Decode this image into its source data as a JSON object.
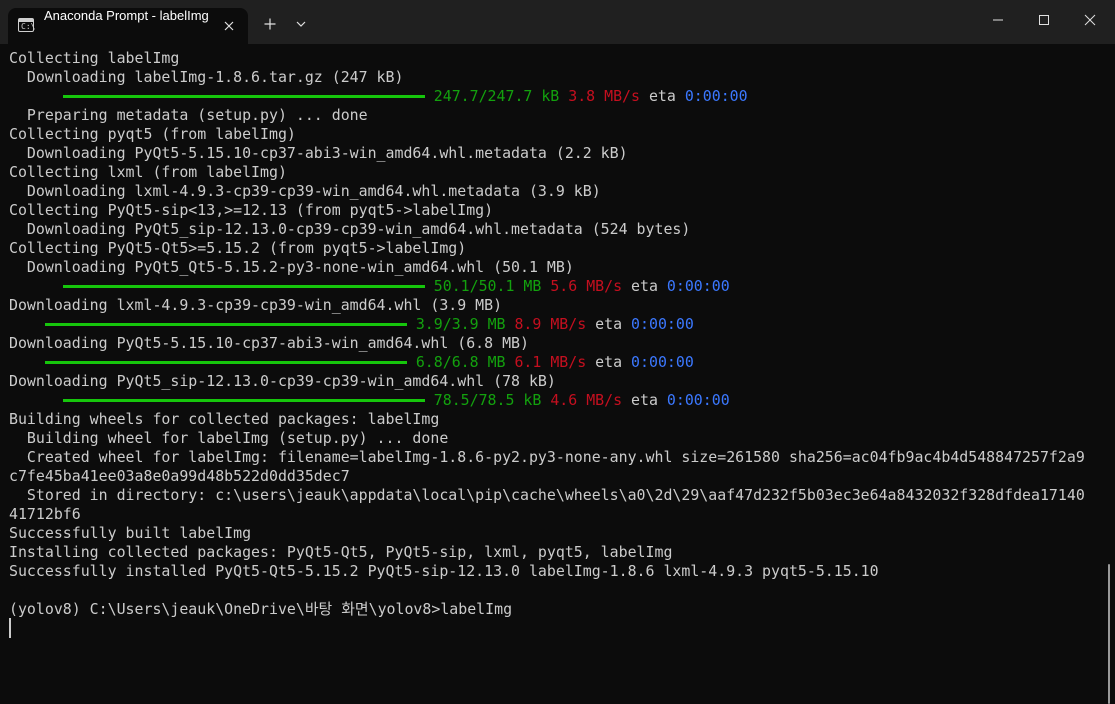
{
  "window": {
    "tab_title": "Anaconda Prompt - labelImg",
    "app_icon": "terminal-icon",
    "app_icon_glyph": "C:\\",
    "new_tab_glyph": "+",
    "controls": [
      "minimize-icon",
      "maximize-icon",
      "close-icon"
    ]
  },
  "colors": {
    "background": "#0c0c0c",
    "titlebar": "#202020",
    "text": "#cccccc",
    "green": "#13a10e",
    "red": "#c50f1f",
    "blue": "#3b78ff",
    "progress": "#16c60c"
  },
  "terminal": {
    "lines": [
      {
        "text": "Collecting labelImg"
      },
      {
        "text": "  Downloading labelImg-1.8.6.tar.gz (247 kB)"
      },
      {
        "progress": {
          "size": "247.7/247.7 kB",
          "speed": "3.8 MB/s",
          "eta_label": "eta",
          "eta": "0:00:00"
        }
      },
      {
        "text": "  Preparing metadata (setup.py) ... done"
      },
      {
        "text": "Collecting pyqt5 (from labelImg)"
      },
      {
        "text": "  Downloading PyQt5-5.15.10-cp37-abi3-win_amd64.whl.metadata (2.2 kB)"
      },
      {
        "text": "Collecting lxml (from labelImg)"
      },
      {
        "text": "  Downloading lxml-4.9.3-cp39-cp39-win_amd64.whl.metadata (3.9 kB)"
      },
      {
        "text": "Collecting PyQt5-sip<13,>=12.13 (from pyqt5->labelImg)"
      },
      {
        "text": "  Downloading PyQt5_sip-12.13.0-cp39-cp39-win_amd64.whl.metadata (524 bytes)"
      },
      {
        "text": "Collecting PyQt5-Qt5>=5.15.2 (from pyqt5->labelImg)"
      },
      {
        "text": "  Downloading PyQt5_Qt5-5.15.2-py3-none-win_amd64.whl (50.1 MB)"
      },
      {
        "progress": {
          "size": "50.1/50.1 MB",
          "speed": "5.6 MB/s",
          "eta_label": "eta",
          "eta": "0:00:00"
        }
      },
      {
        "text": "Downloading lxml-4.9.3-cp39-cp39-win_amd64.whl (3.9 MB)"
      },
      {
        "progress": {
          "size": "3.9/3.9 MB",
          "speed": "8.9 MB/s",
          "eta_label": "eta",
          "eta": "0:00:00"
        }
      },
      {
        "text": "Downloading PyQt5-5.15.10-cp37-abi3-win_amd64.whl (6.8 MB)"
      },
      {
        "progress": {
          "size": "6.8/6.8 MB",
          "speed": "6.1 MB/s",
          "eta_label": "eta",
          "eta": "0:00:00"
        }
      },
      {
        "text": "Downloading PyQt5_sip-12.13.0-cp39-cp39-win_amd64.whl (78 kB)"
      },
      {
        "progress": {
          "size": "78.5/78.5 kB",
          "speed": "4.6 MB/s",
          "eta_label": "eta",
          "eta": "0:00:00"
        }
      },
      {
        "text": "Building wheels for collected packages: labelImg"
      },
      {
        "text": "  Building wheel for labelImg (setup.py) ... done"
      },
      {
        "text": "  Created wheel for labelImg: filename=labelImg-1.8.6-py2.py3-none-any.whl size=261580 sha256=ac04fb9ac4b4d548847257f2a9"
      },
      {
        "text": "c7fe45ba41ee03a8e0a99d48b522d0dd35dec7"
      },
      {
        "text": "  Stored in directory: c:\\users\\jeauk\\appdata\\local\\pip\\cache\\wheels\\a0\\2d\\29\\aaf47d232f5b03ec3e64a8432032f328dfdea17140"
      },
      {
        "text": "41712bf6"
      },
      {
        "text": "Successfully built labelImg"
      },
      {
        "text": "Installing collected packages: PyQt5-Qt5, PyQt5-sip, lxml, pyqt5, labelImg"
      },
      {
        "text": "Successfully installed PyQt5-Qt5-5.15.2 PyQt5-sip-12.13.0 labelImg-1.8.6 lxml-4.9.3 pyqt5-5.15.10"
      },
      {
        "text": ""
      },
      {
        "text": "(yolov8) C:\\Users\\jeauk\\OneDrive\\바탕 화면\\yolov8>labelImg"
      }
    ],
    "progress_indents": [
      6,
      6,
      4,
      4,
      6
    ]
  }
}
